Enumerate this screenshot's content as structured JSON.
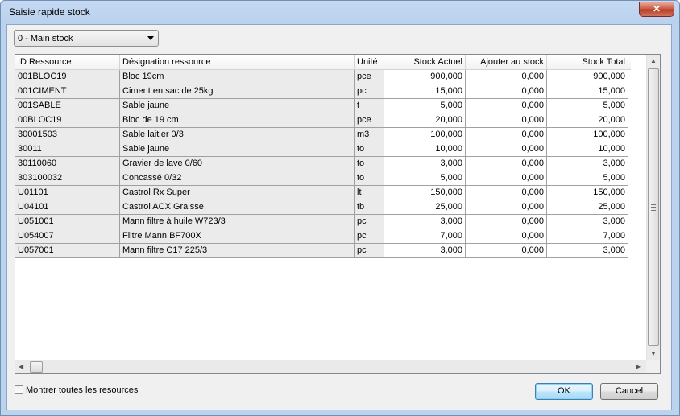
{
  "window": {
    "title": "Saisie rapide stock",
    "close_glyph": "✕"
  },
  "stock_select": {
    "value": "0 - Main stock"
  },
  "grid": {
    "columns": [
      {
        "key": "id",
        "label": "ID Ressource"
      },
      {
        "key": "designation",
        "label": "Désignation ressource"
      },
      {
        "key": "unite",
        "label": "Unité"
      },
      {
        "key": "stock_actuel",
        "label": "Stock Actuel"
      },
      {
        "key": "ajouter",
        "label": "Ajouter au stock"
      },
      {
        "key": "stock_total",
        "label": "Stock Total"
      }
    ],
    "rows": [
      {
        "id": "001BLOC19",
        "designation": "Bloc 19cm",
        "unite": "pce",
        "stock_actuel": "900,000",
        "ajouter": "0,000",
        "stock_total": "900,000"
      },
      {
        "id": "001CIMENT",
        "designation": "Ciment en sac de 25kg",
        "unite": "pc",
        "stock_actuel": "15,000",
        "ajouter": "0,000",
        "stock_total": "15,000"
      },
      {
        "id": "001SABLE",
        "designation": "Sable jaune",
        "unite": "t",
        "stock_actuel": "5,000",
        "ajouter": "0,000",
        "stock_total": "5,000"
      },
      {
        "id": "00BLOC19",
        "designation": "Bloc de 19 cm",
        "unite": "pce",
        "stock_actuel": "20,000",
        "ajouter": "0,000",
        "stock_total": "20,000"
      },
      {
        "id": "30001503",
        "designation": "Sable laitier 0/3",
        "unite": "m3",
        "stock_actuel": "100,000",
        "ajouter": "0,000",
        "stock_total": "100,000"
      },
      {
        "id": "30011",
        "designation": "Sable jaune",
        "unite": "to",
        "stock_actuel": "10,000",
        "ajouter": "0,000",
        "stock_total": "10,000"
      },
      {
        "id": "30110060",
        "designation": "Gravier de lave 0/60",
        "unite": "to",
        "stock_actuel": "3,000",
        "ajouter": "0,000",
        "stock_total": "3,000"
      },
      {
        "id": "303100032",
        "designation": "Concassé 0/32",
        "unite": "to",
        "stock_actuel": "5,000",
        "ajouter": "0,000",
        "stock_total": "5,000"
      },
      {
        "id": "U01101",
        "designation": "Castrol Rx Super",
        "unite": "lt",
        "stock_actuel": "150,000",
        "ajouter": "0,000",
        "stock_total": "150,000"
      },
      {
        "id": "U04101",
        "designation": "Castrol ACX Graisse",
        "unite": "tb",
        "stock_actuel": "25,000",
        "ajouter": "0,000",
        "stock_total": "25,000"
      },
      {
        "id": "U051001",
        "designation": "Mann filtre à huile W723/3",
        "unite": "pc",
        "stock_actuel": "3,000",
        "ajouter": "0,000",
        "stock_total": "3,000"
      },
      {
        "id": "U054007",
        "designation": "Filtre Mann BF700X",
        "unite": "pc",
        "stock_actuel": "7,000",
        "ajouter": "0,000",
        "stock_total": "7,000"
      },
      {
        "id": "U057001",
        "designation": "Mann filtre C17 225/3",
        "unite": "pc",
        "stock_actuel": "3,000",
        "ajouter": "0,000",
        "stock_total": "3,000"
      }
    ]
  },
  "show_all": {
    "label": "Montrer toutes les resources",
    "checked": false
  },
  "buttons": {
    "ok": "OK",
    "cancel": "Cancel"
  },
  "scroll_arrows": {
    "up": "▲",
    "down": "▼",
    "left": "◀",
    "right": "▶"
  }
}
